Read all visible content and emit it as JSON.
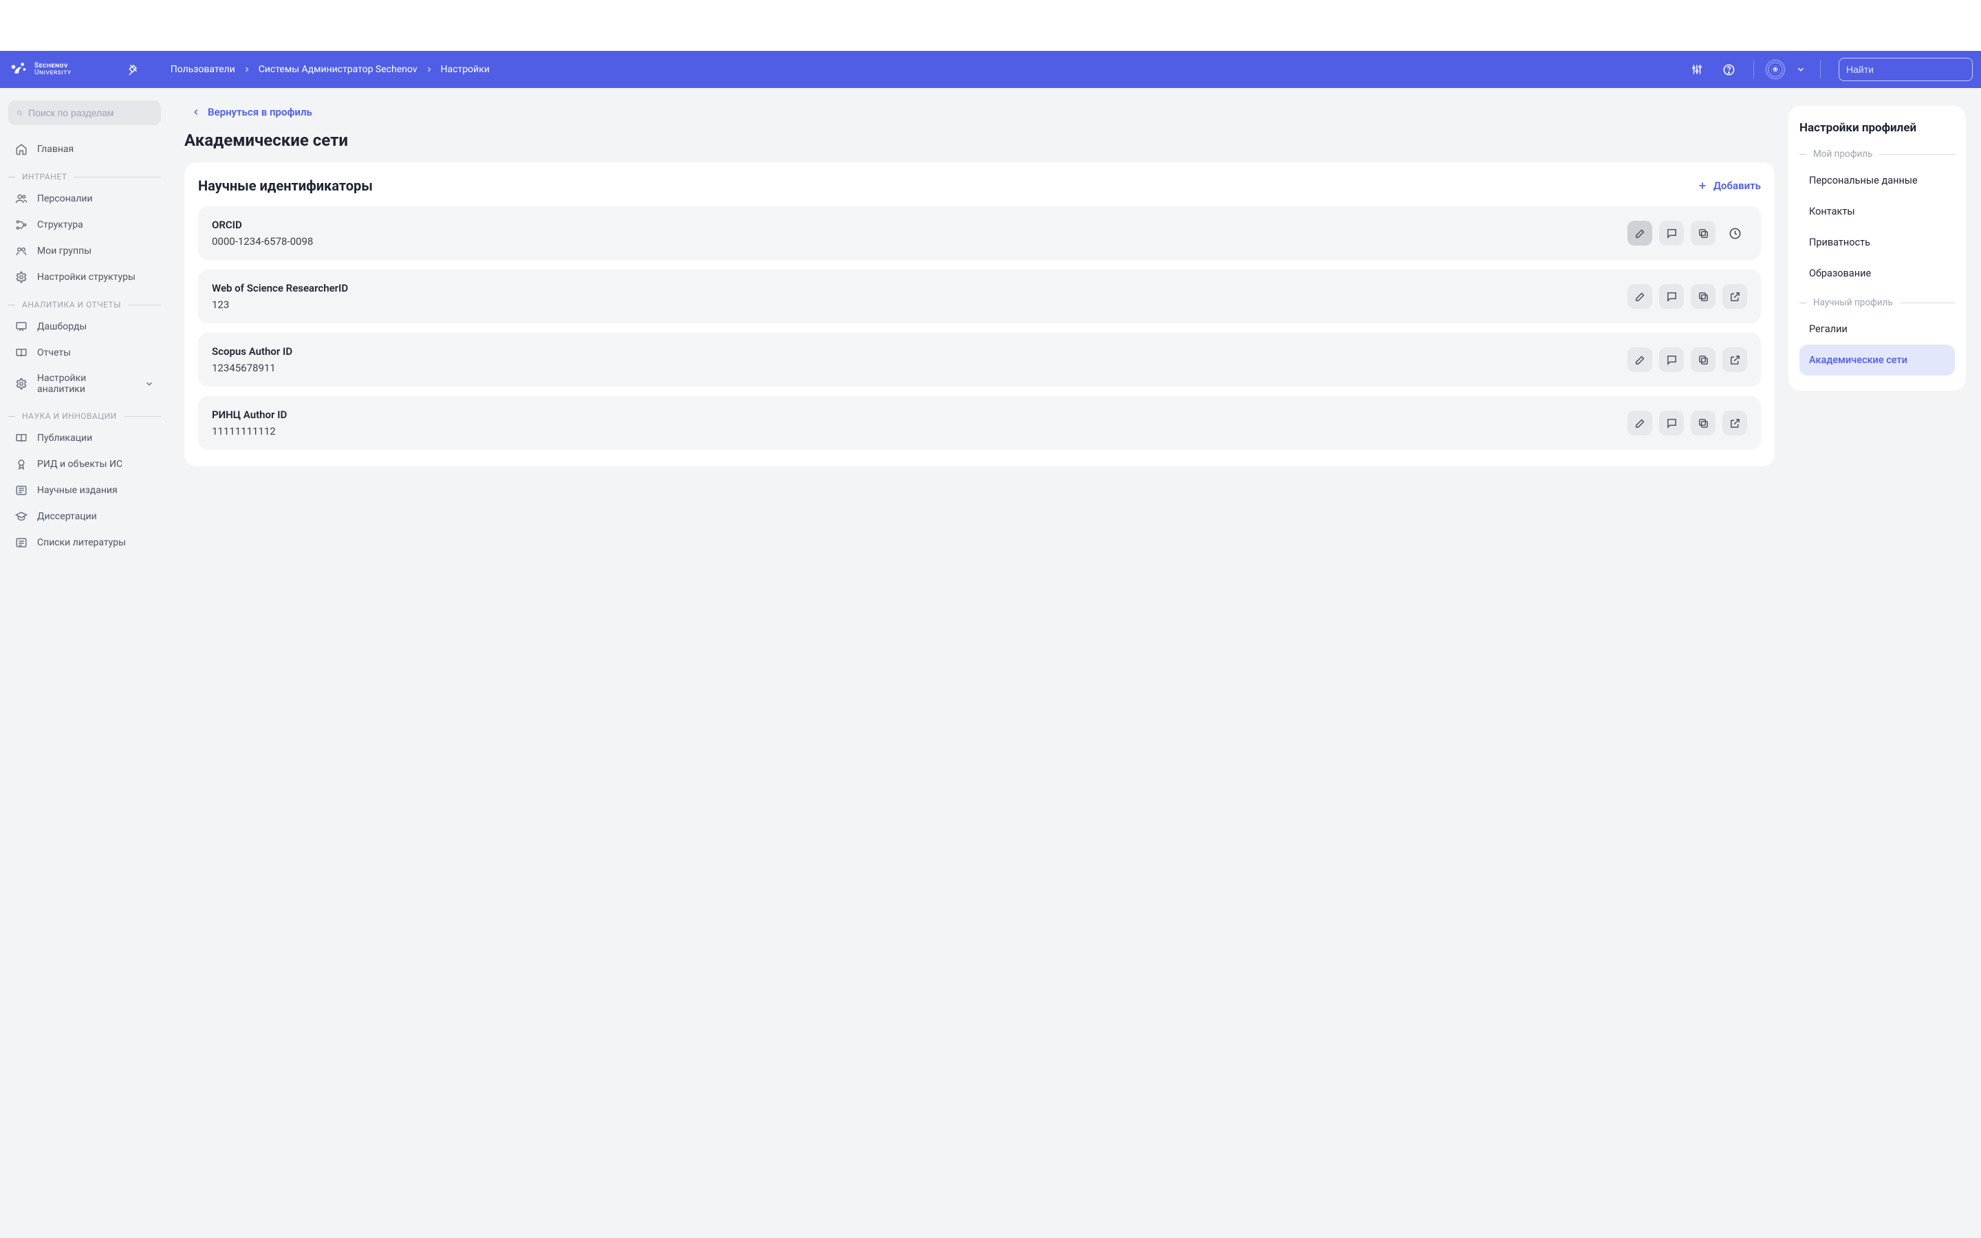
{
  "brand": {
    "line1": "Sechenov",
    "line2": "University"
  },
  "breadcrumbs": [
    "Пользователи",
    "Системы Администратор Sechenov",
    "Настройки"
  ],
  "search": {
    "global_placeholder": "Найти",
    "side_placeholder": "Поиск по разделам"
  },
  "sidebar": {
    "groups": [
      {
        "label": "ИНТРАНЕТ"
      },
      {
        "label": "АНАЛИТИКА И ОТЧЕТЫ"
      },
      {
        "label": "НАУКА И ИННОВАЦИИ"
      }
    ],
    "items": {
      "home": "Главная",
      "personalii": "Персоналии",
      "structure": "Структура",
      "mygroups": "Мои группы",
      "struct_settings": "Настройки структуры",
      "dashboards": "Дашборды",
      "reports": "Отчеты",
      "analytics_settings": "Настройки аналитики",
      "publications": "Публикации",
      "rid": "РИД и объекты ИС",
      "sci_eds": "Научные издания",
      "dissertations": "Диссертации",
      "bibl": "Списки литературы"
    }
  },
  "back_link": "Вернуться в профиль",
  "page_title": "Академические сети",
  "card": {
    "title": "Научные идентификаторы",
    "add_label": "Добавить",
    "rows": [
      {
        "name": "ORCID",
        "value": "0000-1234-6578-0098",
        "has_external": false,
        "first_hover": true
      },
      {
        "name": "Web of Science ResearcherID",
        "value": "123",
        "has_external": true
      },
      {
        "name": "Scopus Author ID",
        "value": "12345678911",
        "has_external": true
      },
      {
        "name": "РИНЦ Author ID",
        "value": "11111111112",
        "has_external": true
      }
    ]
  },
  "right_panel": {
    "title": "Настройки профилей",
    "group1": "Мой профиль",
    "items1": [
      "Персональные данные",
      "Контакты",
      "Приватность",
      "Образование"
    ],
    "group2": "Научный профиль",
    "items2": [
      "Регалии",
      "Академические сети"
    ],
    "active_index2": 1
  }
}
